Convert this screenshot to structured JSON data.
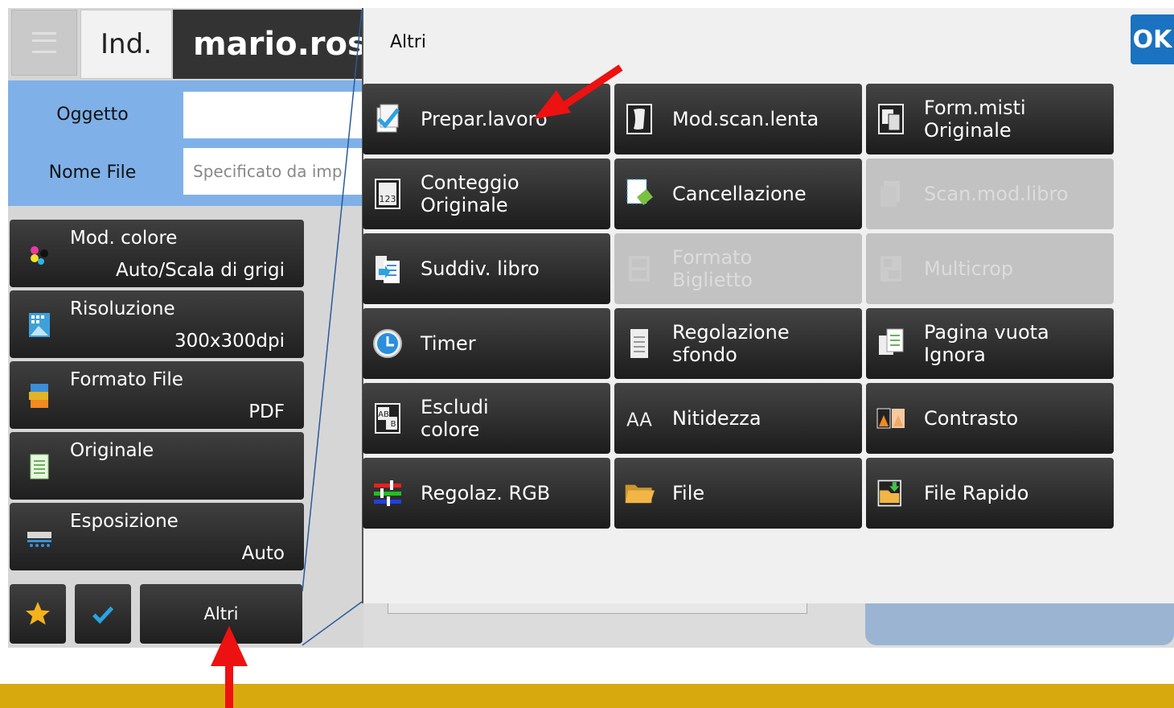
{
  "header": {
    "tab_index_label": "Ind.",
    "tab_user_label": "mario.ros"
  },
  "address": {
    "subject_label": "Oggetto",
    "subject_value": "",
    "filename_label": "Nome File",
    "filename_placeholder": "Specificato da imp"
  },
  "left_buttons": [
    {
      "title": "Mod. colore",
      "value": "Auto/Scala di grigi",
      "icon": "color-mode-icon"
    },
    {
      "title": "Risoluzione",
      "value": "300x300dpi",
      "icon": "resolution-icon"
    },
    {
      "title": "Formato File",
      "value": "PDF",
      "icon": "file-format-icon"
    },
    {
      "title": "Originale",
      "value": "",
      "icon": "original-icon"
    },
    {
      "title": "Esposizione",
      "value": "Auto",
      "icon": "exposure-icon"
    }
  ],
  "bottom_bar": {
    "favorite_icon": "star-icon",
    "check_icon": "checkmark-icon",
    "others_label": "Altri"
  },
  "popup": {
    "title": "Altri",
    "ok_label": "OK",
    "items": [
      {
        "label": "Prepar.lavoro",
        "icon": "job-build-icon",
        "enabled": true
      },
      {
        "label": "Mod.scan.lenta",
        "icon": "slow-scan-icon",
        "enabled": true
      },
      {
        "label": "Form.misti\nOriginale",
        "icon": "mixed-size-icon",
        "enabled": true
      },
      {
        "label": "Conteggio\nOriginale",
        "icon": "original-count-icon",
        "enabled": true
      },
      {
        "label": "Cancellazione",
        "icon": "erase-icon",
        "enabled": true
      },
      {
        "label": "Scan.mod.libro",
        "icon": "book-scan-icon",
        "enabled": false
      },
      {
        "label": "Suddiv. libro",
        "icon": "book-divide-icon",
        "enabled": true
      },
      {
        "label": "Formato\nBiglietto",
        "icon": "card-format-icon",
        "enabled": false
      },
      {
        "label": "Multicrop",
        "icon": "multicrop-icon",
        "enabled": false
      },
      {
        "label": "Timer",
        "icon": "timer-icon",
        "enabled": true
      },
      {
        "label": "Regolazione\nsfondo",
        "icon": "background-adjust-icon",
        "enabled": true
      },
      {
        "label": "Pagina vuota\nIgnora",
        "icon": "blank-page-skip-icon",
        "enabled": true
      },
      {
        "label": "Escludi\ncolore",
        "icon": "color-exclude-icon",
        "enabled": true
      },
      {
        "label": "Nitidezza",
        "icon": "sharpness-icon",
        "enabled": true
      },
      {
        "label": "Contrasto",
        "icon": "contrast-icon",
        "enabled": true
      },
      {
        "label": "Regolaz. RGB",
        "icon": "rgb-adjust-icon",
        "enabled": true
      },
      {
        "label": "File",
        "icon": "folder-icon",
        "enabled": true
      },
      {
        "label": "File Rapido",
        "icon": "quick-file-icon",
        "enabled": true
      }
    ]
  },
  "colors": {
    "accent_blue": "#1a72c0",
    "address_blue": "#7fb1e8",
    "annotation_red": "#ee1111",
    "bottom_bar": "#d8a90e"
  }
}
